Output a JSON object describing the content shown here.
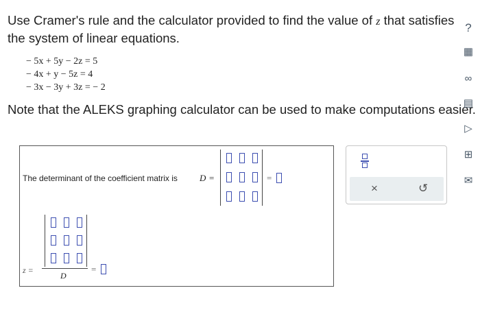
{
  "prompt": {
    "text_before": "Use Cramer's rule and the calculator provided to find the value of ",
    "variable": "z",
    "text_after": " that satisfies the system of linear equations."
  },
  "equations": [
    "− 5x + 5y − 2z = 5",
    "− 4x + y − 5z = 4",
    "− 3x − 3y + 3z = − 2"
  ],
  "note": "Note that the ALEKS graphing calculator can be used to make computations easier.",
  "answer": {
    "det_label": "The determinant of the coefficient matrix is",
    "det_variable": "D",
    "equals": "=",
    "z_variable": "z =",
    "denominator": "D"
  },
  "tools": {
    "fraction_icon": "fraction-template-icon",
    "clear_label": "×",
    "undo_label": "↺"
  },
  "side_toolbar": [
    {
      "icon": "help-icon",
      "glyph": "?"
    },
    {
      "icon": "calculator-icon",
      "glyph": "▦"
    },
    {
      "icon": "infinity-icon",
      "glyph": "∞"
    },
    {
      "icon": "notes-icon",
      "glyph": "▤"
    },
    {
      "icon": "video-icon",
      "glyph": "▷"
    },
    {
      "icon": "textbook-icon",
      "glyph": "⊞"
    },
    {
      "icon": "mail-icon",
      "glyph": "✉"
    }
  ]
}
